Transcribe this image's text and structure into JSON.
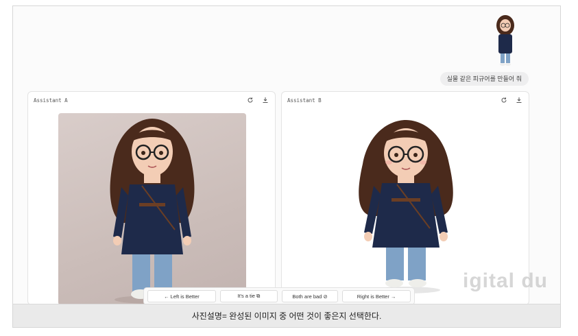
{
  "chat": {
    "user_message": "실물 같은 피규어를 만들어 줘"
  },
  "panels": {
    "a": {
      "title": "Assistant A",
      "refresh_icon": "refresh-icon",
      "download_icon": "download-icon"
    },
    "b": {
      "title": "Assistant B",
      "refresh_icon": "refresh-icon",
      "download_icon": "download-icon"
    }
  },
  "vote": {
    "left_better": "← Left is Better",
    "tie": "It's a tie ⧉",
    "both_bad": "Both are bad ⊘",
    "right_better": "Right is Better →"
  },
  "watermark": "igital du",
  "caption": "사진설명= 완성된 이미지 중 어떤 것이 좋은지 선택한다.",
  "colors": {
    "coat": "#1e2a4a",
    "hair": "#4a2a1c",
    "jeans": "#7fa2c6",
    "background_a": "#cbbdb9",
    "caption_bg": "#eaeaea"
  }
}
